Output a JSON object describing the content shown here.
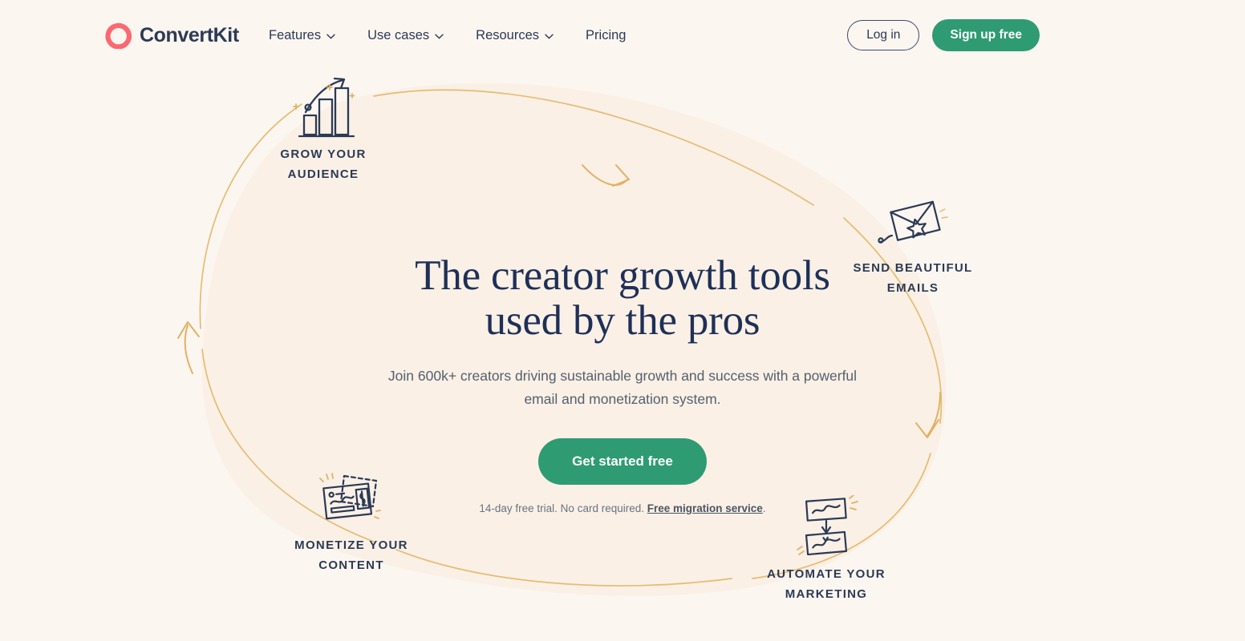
{
  "brand": {
    "name": "ConvertKit",
    "logo_icon": "convertkit-circle-logo",
    "logo_color": "#FB6970",
    "text_color": "#2B3A55"
  },
  "nav": {
    "items": [
      {
        "label": "Features",
        "has_dropdown": true,
        "icon": "chevron-down-icon"
      },
      {
        "label": "Use cases",
        "has_dropdown": true,
        "icon": "chevron-down-icon"
      },
      {
        "label": "Resources",
        "has_dropdown": true,
        "icon": "chevron-down-icon"
      },
      {
        "label": "Pricing",
        "has_dropdown": false,
        "icon": ""
      }
    ]
  },
  "header_actions": {
    "login_label": "Log in",
    "signup_label": "Sign up free",
    "accent_green": "#2E9B72",
    "outline_color": "#3C4A6B"
  },
  "hero": {
    "title_line_1": "The creator growth tools",
    "title_line_2": "used by the pros",
    "subtitle": "Join 600k+ creators driving sustainable growth and success with a powerful email and monetization system.",
    "cta_label": "Get started free",
    "note_prefix": "14-day free trial. No card required. ",
    "note_link": "Free migration service",
    "note_suffix": ".",
    "title_color": "#1F3057",
    "subtitle_color": "#55606E"
  },
  "orbit": {
    "items": [
      {
        "id": "grow",
        "label": "Grow your\naudience",
        "icon": "bar-chart-growth-icon"
      },
      {
        "id": "email",
        "label": "Send beautiful\nemails",
        "icon": "envelope-star-icon"
      },
      {
        "id": "automate",
        "label": "Automate your\nmarketing",
        "icon": "automation-flow-icon"
      },
      {
        "id": "monetize",
        "label": "Monetize your\ncontent",
        "icon": "content-card-icon"
      }
    ],
    "flow_line_color": "#E4B96B",
    "blob_color": "#FAF0E6",
    "arrow_count": 4
  },
  "page": {
    "background": "#FCF6F1"
  }
}
